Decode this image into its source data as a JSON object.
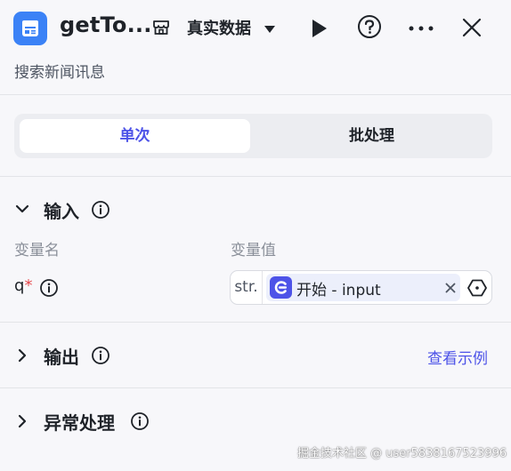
{
  "header": {
    "title": "getTo...",
    "data_source": "真实数据"
  },
  "subtitle": "搜索新闻讯息",
  "tabs": {
    "single": "单次",
    "batch": "批处理"
  },
  "input_section": {
    "title": "输入",
    "col_name": "变量名",
    "col_value": "变量值",
    "param": {
      "name": "q",
      "required_mark": "*",
      "type": "str.",
      "ref_label": "开始 - input"
    }
  },
  "output_section": {
    "title": "输出",
    "example_link": "查看示例"
  },
  "error_section": {
    "title": "异常处理"
  },
  "watermark": "掘金技术社区 @ user5838167523996",
  "colors": {
    "accent": "#4d53e8",
    "app_icon": "#3b82f6",
    "required": "#e5484d"
  }
}
